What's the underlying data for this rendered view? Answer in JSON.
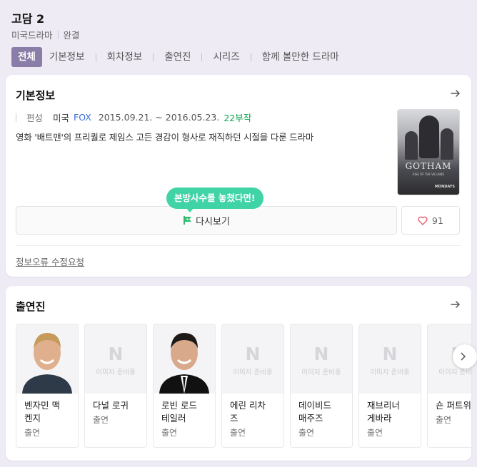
{
  "header": {
    "title": "고담 2",
    "genre": "미국드라마",
    "status": "완결"
  },
  "tabs": [
    {
      "label": "전체",
      "active": true
    },
    {
      "label": "기본정보"
    },
    {
      "label": "회차정보"
    },
    {
      "label": "출연진"
    },
    {
      "label": "시리즈"
    },
    {
      "label": "함께 볼만한 드라마"
    }
  ],
  "basic_info": {
    "section_title": "기본정보",
    "label": "편성",
    "country": "미국",
    "network": "FOX",
    "dates": "2015.09.21. ~ 2016.05.23.",
    "episodes": "22부작",
    "description": "영화 '배트맨'의 프리퀄로 제임스 고든 경감이 형사로 재직하던 시절을 다룬 드라마",
    "poster": {
      "title": "GOTHAM",
      "subtitle": "RISE OF THE VILLAINS",
      "network_text": "MONDAYS"
    },
    "tooltip": "본방사수를 놓쳤다면!",
    "rewatch_label": "다시보기",
    "like_count": "91",
    "report_label": "정보오류 수정요청",
    "colors": {
      "accent": "#8a7da8",
      "network": "#3a6fd8",
      "episodes": "#0ca350",
      "tooltip": "#3fd3a6",
      "heart": "#e85d6f"
    }
  },
  "cast": {
    "section_title": "출연진",
    "placeholder_mark": "N",
    "placeholder_text": "이미지 준비중",
    "members": [
      {
        "name": "벤자민 맥켄지",
        "name_lines": [
          "벤자민 맥",
          "켄지"
        ],
        "role": "출연",
        "has_photo": true
      },
      {
        "name": "다널 로귀",
        "name_lines": [
          "다널 로귀"
        ],
        "role": "출연",
        "has_photo": false
      },
      {
        "name": "로빈 로드 테일러",
        "name_lines": [
          "로빈 로드",
          "테일러"
        ],
        "role": "출연",
        "has_photo": true
      },
      {
        "name": "에린 리차즈",
        "name_lines": [
          "에린 리차",
          "즈"
        ],
        "role": "출연",
        "has_photo": false
      },
      {
        "name": "데이비드 매주즈",
        "name_lines": [
          "데이비드",
          "매주즈"
        ],
        "role": "출연",
        "has_photo": false
      },
      {
        "name": "재브리너 게바라",
        "name_lines": [
          "재브리너",
          "게바라"
        ],
        "role": "출연",
        "has_photo": false
      },
      {
        "name": "숀 퍼트위",
        "name_lines": [
          "숀 퍼트위"
        ],
        "role": "출연",
        "has_photo": false
      }
    ]
  },
  "icons": {
    "section_arrow": "arrow-right-icon",
    "rewatch": "play-flag-icon",
    "like": "heart-icon",
    "carousel_next": "chevron-right-icon"
  }
}
